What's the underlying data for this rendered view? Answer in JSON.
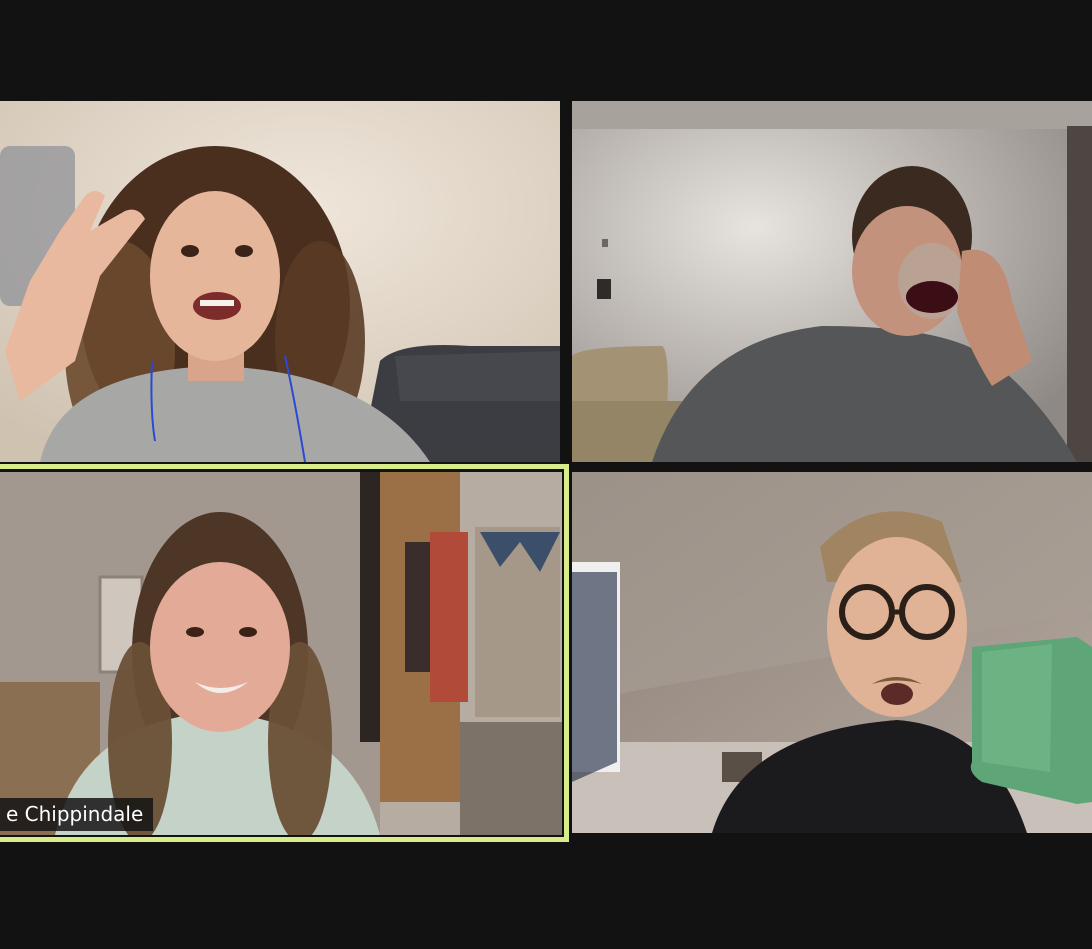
{
  "app": {
    "layout": "gallery-view",
    "background_color": "#121212",
    "active_speaker_border_color": "#d9ec8a"
  },
  "participants": [
    {
      "tile": "top-left",
      "is_active_speaker": false,
      "name_label": ""
    },
    {
      "tile": "top-right",
      "is_active_speaker": false,
      "name_label": ""
    },
    {
      "tile": "bottom-left",
      "is_active_speaker": true,
      "name_label": "e Chippindale"
    },
    {
      "tile": "bottom-right",
      "is_active_speaker": false,
      "name_label": ""
    }
  ]
}
